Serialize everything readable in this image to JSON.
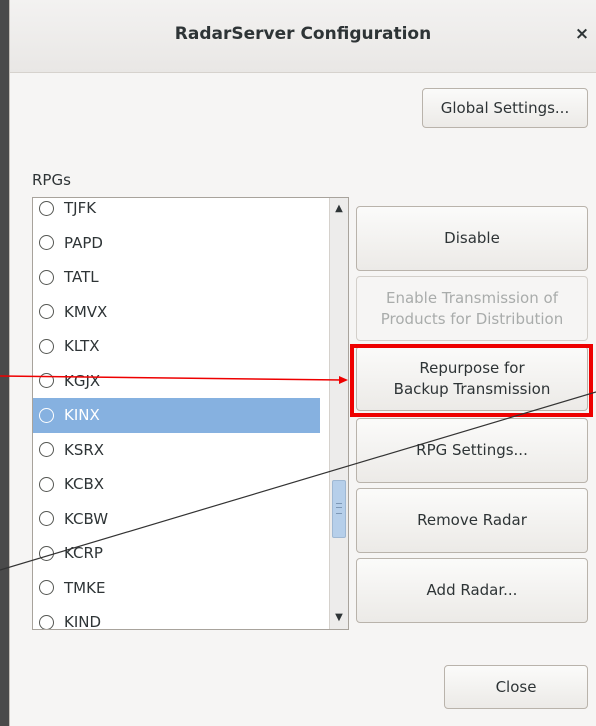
{
  "dialog": {
    "title": "RadarServer Configuration",
    "close_glyph": "×",
    "global_settings_label": "Global Settings..."
  },
  "rpgs": {
    "label": "RPGs",
    "items": [
      {
        "name": "TJFK",
        "selected": false
      },
      {
        "name": "PAPD",
        "selected": false
      },
      {
        "name": "TATL",
        "selected": false
      },
      {
        "name": "KMVX",
        "selected": false
      },
      {
        "name": "KLTX",
        "selected": false
      },
      {
        "name": "KGJX",
        "selected": false
      },
      {
        "name": "KINX",
        "selected": true
      },
      {
        "name": "KSRX",
        "selected": false
      },
      {
        "name": "KCBX",
        "selected": false
      },
      {
        "name": "KCBW",
        "selected": false
      },
      {
        "name": "KCRP",
        "selected": false
      },
      {
        "name": "TMKE",
        "selected": false
      },
      {
        "name": "KIND",
        "selected": false
      }
    ]
  },
  "actions": {
    "disable": "Disable",
    "enable_transmission": "Enable Transmission of\nProducts for Distribution",
    "repurpose": "Repurpose for\nBackup Transmission",
    "rpg_settings": "RPG Settings...",
    "remove_radar": "Remove Radar",
    "add_radar": "Add Radar...",
    "close": "Close"
  },
  "annotation": {
    "highlight_color": "#ee0000",
    "line_color": "#333333"
  }
}
